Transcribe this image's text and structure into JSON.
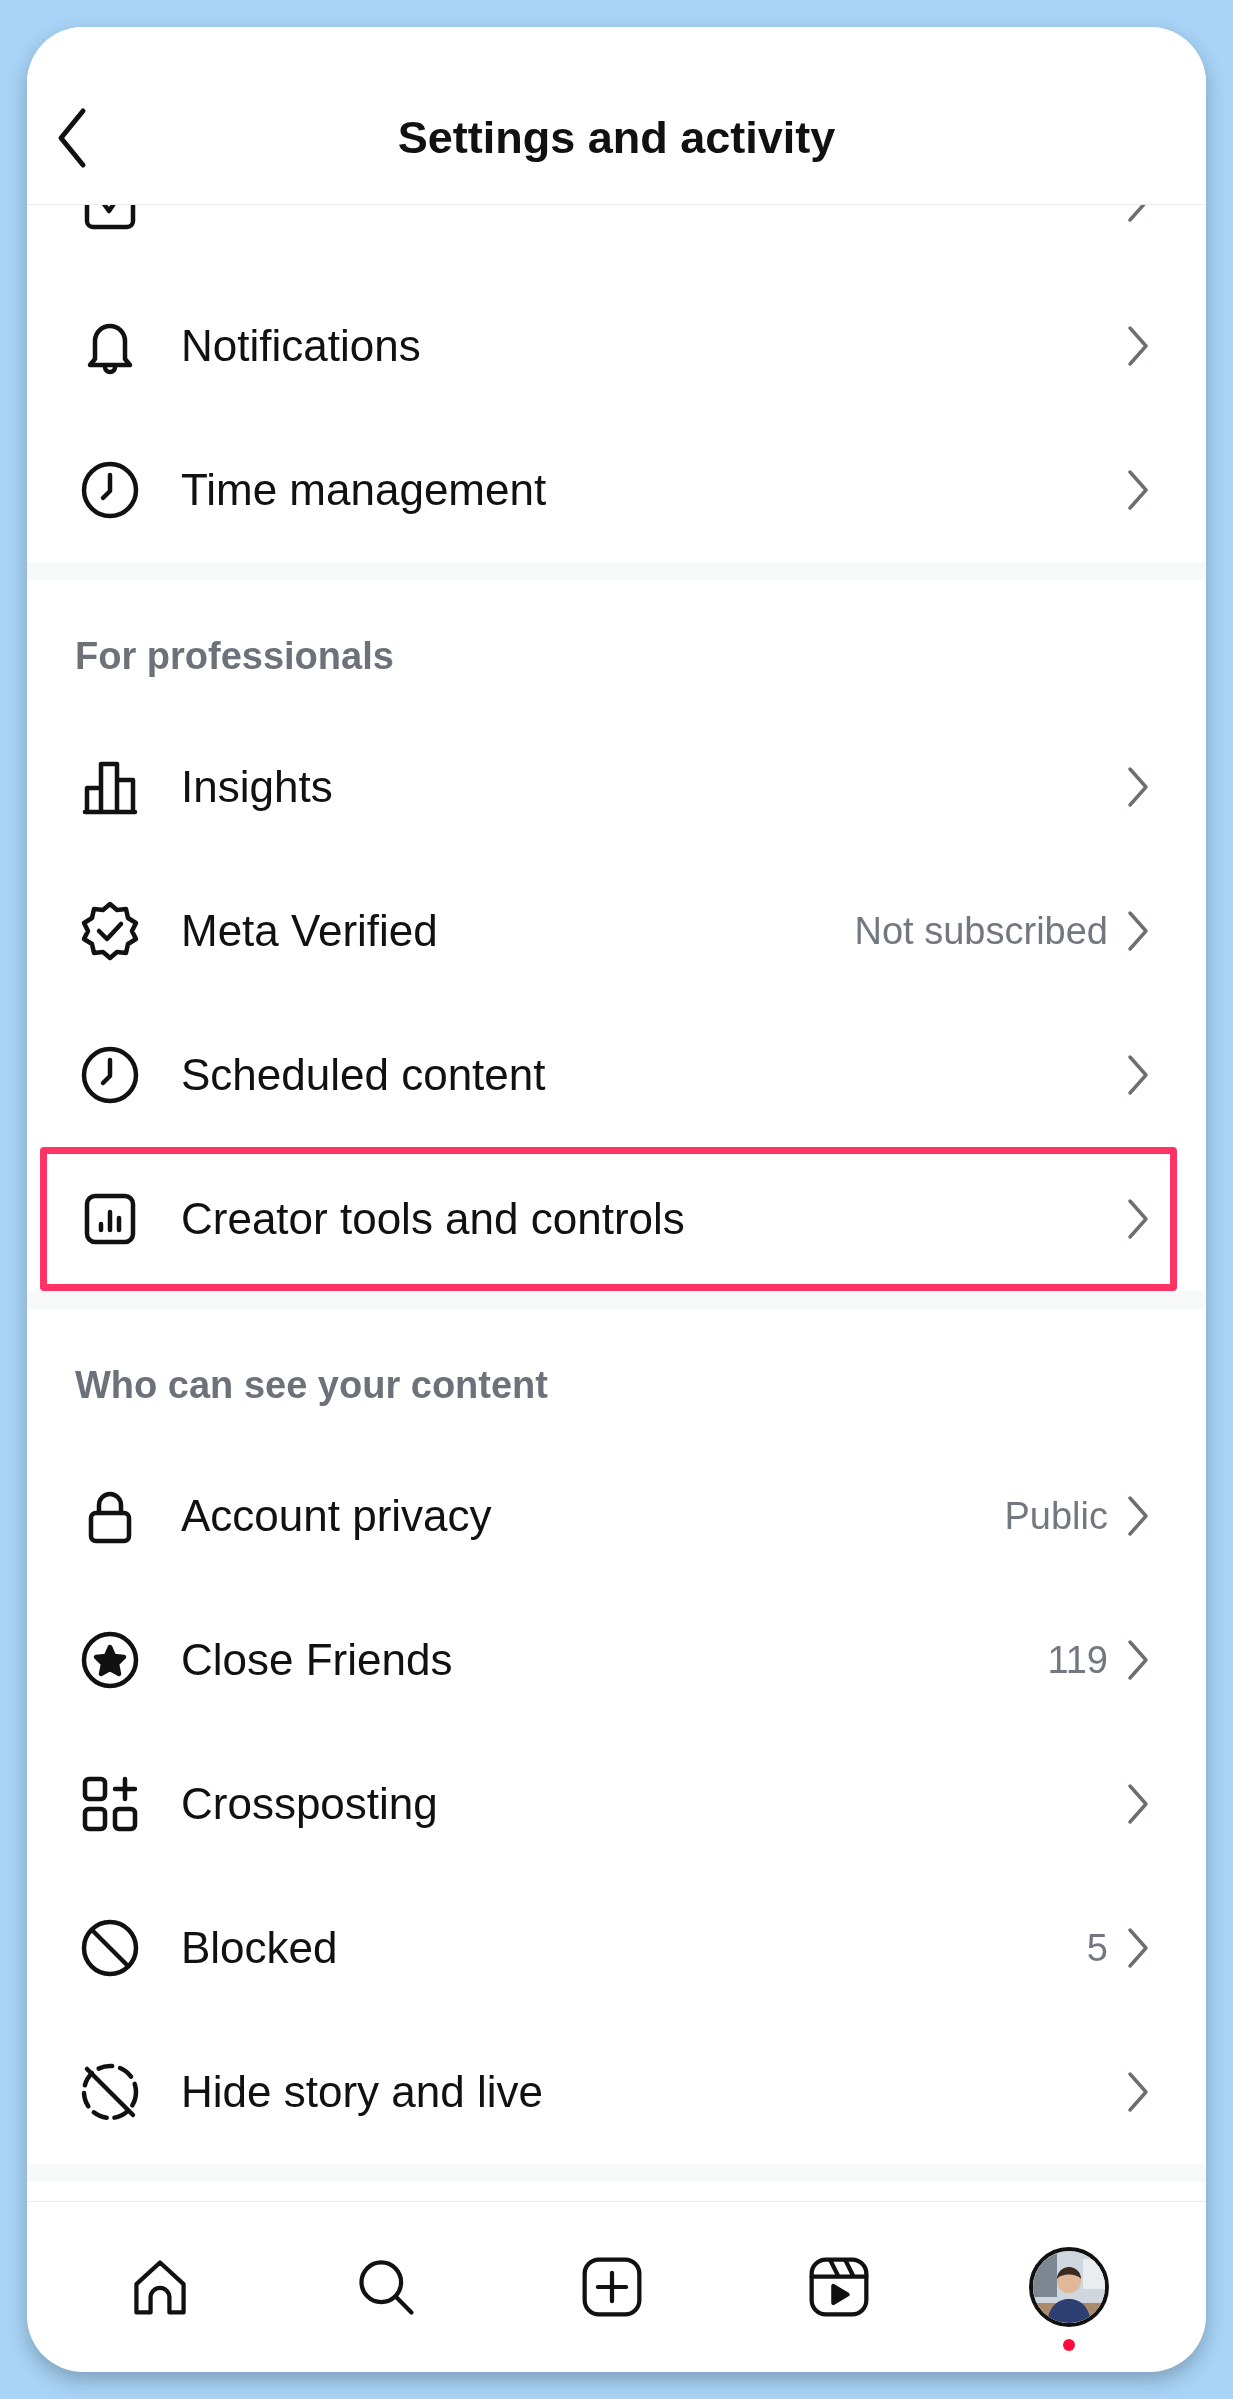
{
  "header": {
    "title": "Settings and activity"
  },
  "sections": [
    {
      "rows": [
        {
          "partial": true,
          "highlighted": false
        },
        {
          "label": "Notifications",
          "partial": false,
          "highlighted": false
        },
        {
          "label": "Time management",
          "partial": false,
          "highlighted": false
        }
      ]
    },
    {
      "title": "For professionals",
      "rows": [
        {
          "label": "Insights",
          "partial": false,
          "highlighted": false
        },
        {
          "label": "Meta Verified",
          "value": "Not subscribed",
          "partial": false,
          "highlighted": false
        },
        {
          "label": "Scheduled content",
          "partial": false,
          "highlighted": false
        },
        {
          "label": "Creator tools and controls",
          "partial": false,
          "highlighted": true
        }
      ]
    },
    {
      "title": "Who can see your content",
      "rows": [
        {
          "label": "Account privacy",
          "value": "Public",
          "partial": false,
          "highlighted": false
        },
        {
          "label": "Close Friends",
          "value": "119",
          "partial": false,
          "highlighted": false
        },
        {
          "label": "Crossposting",
          "partial": false,
          "highlighted": false
        },
        {
          "label": "Blocked",
          "value": "5",
          "partial": false,
          "highlighted": false
        },
        {
          "label": "Hide story and live",
          "partial": false,
          "highlighted": false
        }
      ]
    }
  ],
  "nav": {
    "notification_dot": true
  }
}
